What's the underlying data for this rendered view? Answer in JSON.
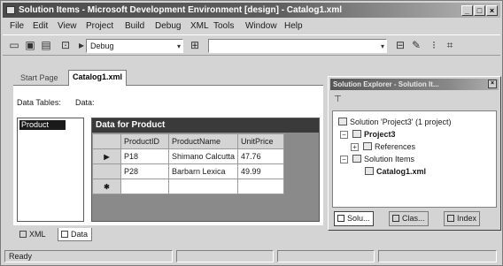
{
  "window": {
    "title": "Solution Items - Microsoft Development Environment [design] - Catalog1.xml",
    "buttons": {
      "minimize": "_",
      "maximize": "□",
      "close": "×"
    }
  },
  "menubar": {
    "items": [
      "File",
      "Edit",
      "View",
      "Project",
      "Build",
      "Debug",
      "XML",
      "Tools",
      "Window",
      "Help"
    ]
  },
  "toolbar": {
    "config_combo": "Debug",
    "search_combo": "",
    "icons": [
      "new-project-icon",
      "save-icon",
      "save-all-icon",
      "toolbox-icon",
      "start-icon",
      "find-icon",
      "properties-icon"
    ]
  },
  "editor": {
    "tabs": [
      "Start Page",
      "Catalog1.xml"
    ],
    "active_tab": "Catalog1.xml",
    "data_tables_label": "Data Tables:",
    "data_label": "Data:",
    "tables": [
      "Product"
    ],
    "grid": {
      "caption": "Data for Product",
      "columns": [
        "ProductID",
        "ProductName",
        "UnitPrice"
      ],
      "rows": [
        {
          "marker": "▶",
          "cells": [
            "P18",
            "Shimano Calcutta",
            "47.76"
          ]
        },
        {
          "marker": "",
          "cells": [
            "P28",
            "Barbarn Lexica",
            "49.99"
          ]
        },
        {
          "marker": "✱",
          "cells": [
            "",
            "",
            ""
          ]
        }
      ]
    },
    "view_tabs": [
      "XML",
      "Data"
    ],
    "active_view": "Data"
  },
  "status": {
    "text": "Ready"
  },
  "solution_explorer": {
    "title": "Solution Explorer - Solution It...",
    "close": "×",
    "tree": {
      "solution": "Solution 'Project3' (1 project)",
      "project": "Project3",
      "references": "References",
      "solution_items": "Solution Items",
      "file": "Catalog1.xml"
    },
    "tabs": [
      "Solu...",
      "Clas...",
      "Index"
    ]
  }
}
